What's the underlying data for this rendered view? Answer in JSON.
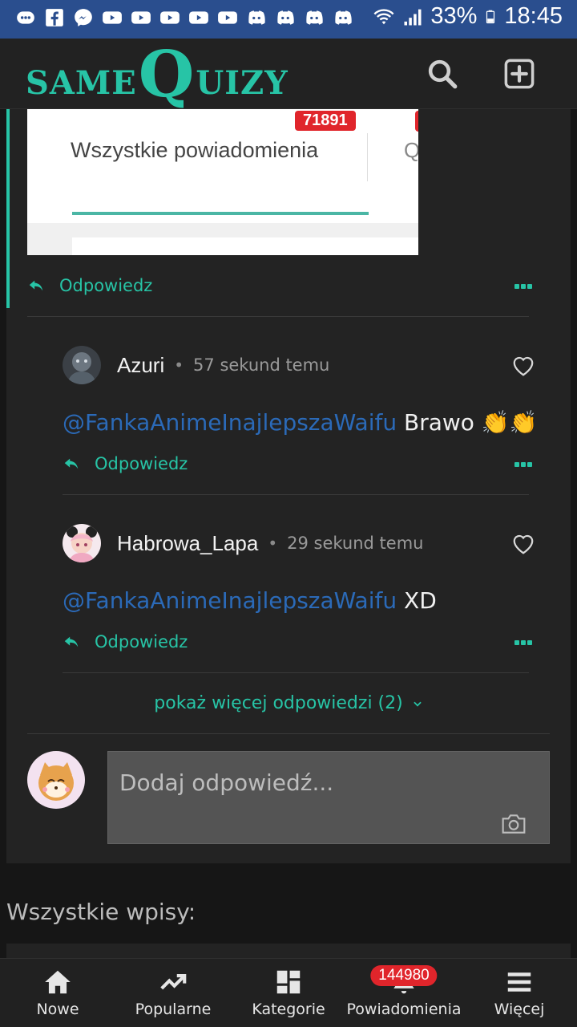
{
  "status_bar": {
    "battery": "33%",
    "time": "18:45"
  },
  "header": {
    "logo_prefix": "SAME",
    "logo_q": "Q",
    "logo_suffix": "UIZY",
    "search_icon": "search-icon",
    "add_icon": "plus-square-icon"
  },
  "embedded_image": {
    "badge_count": "71891",
    "tab_label": "Wszystkie powiadomienia",
    "peek_text": "Q"
  },
  "reply_label": "Odpowiedz",
  "comments": [
    {
      "author": "Azuri",
      "time": "57 sekund temu",
      "mention": "@FankaAnimeInajlepszaWaifu",
      "text": " Brawo 👏👏"
    },
    {
      "author": "Habrowa_Lapa",
      "time": "29 sekund temu",
      "mention": "@FankaAnimeInajlepszaWaifu",
      "text": " XD"
    }
  ],
  "show_more": "pokaż więcej odpowiedzi (2)",
  "reply_input": {
    "placeholder": "Dodaj odpowiedź..."
  },
  "section_title": "Wszystkie wpisy:",
  "bottom_nav": {
    "items": [
      {
        "label": "Nowe",
        "icon": "home-icon"
      },
      {
        "label": "Popularne",
        "icon": "trending-icon"
      },
      {
        "label": "Kategorie",
        "icon": "grid-icon"
      },
      {
        "label": "Powiadomienia",
        "icon": "bell-icon",
        "badge": "144980"
      },
      {
        "label": "Więcej",
        "icon": "menu-icon"
      }
    ]
  },
  "colors": {
    "accent": "#27c4a6",
    "mention": "#2b6ab8",
    "badge": "#e0252b",
    "status_bar": "#2a4e8e"
  }
}
